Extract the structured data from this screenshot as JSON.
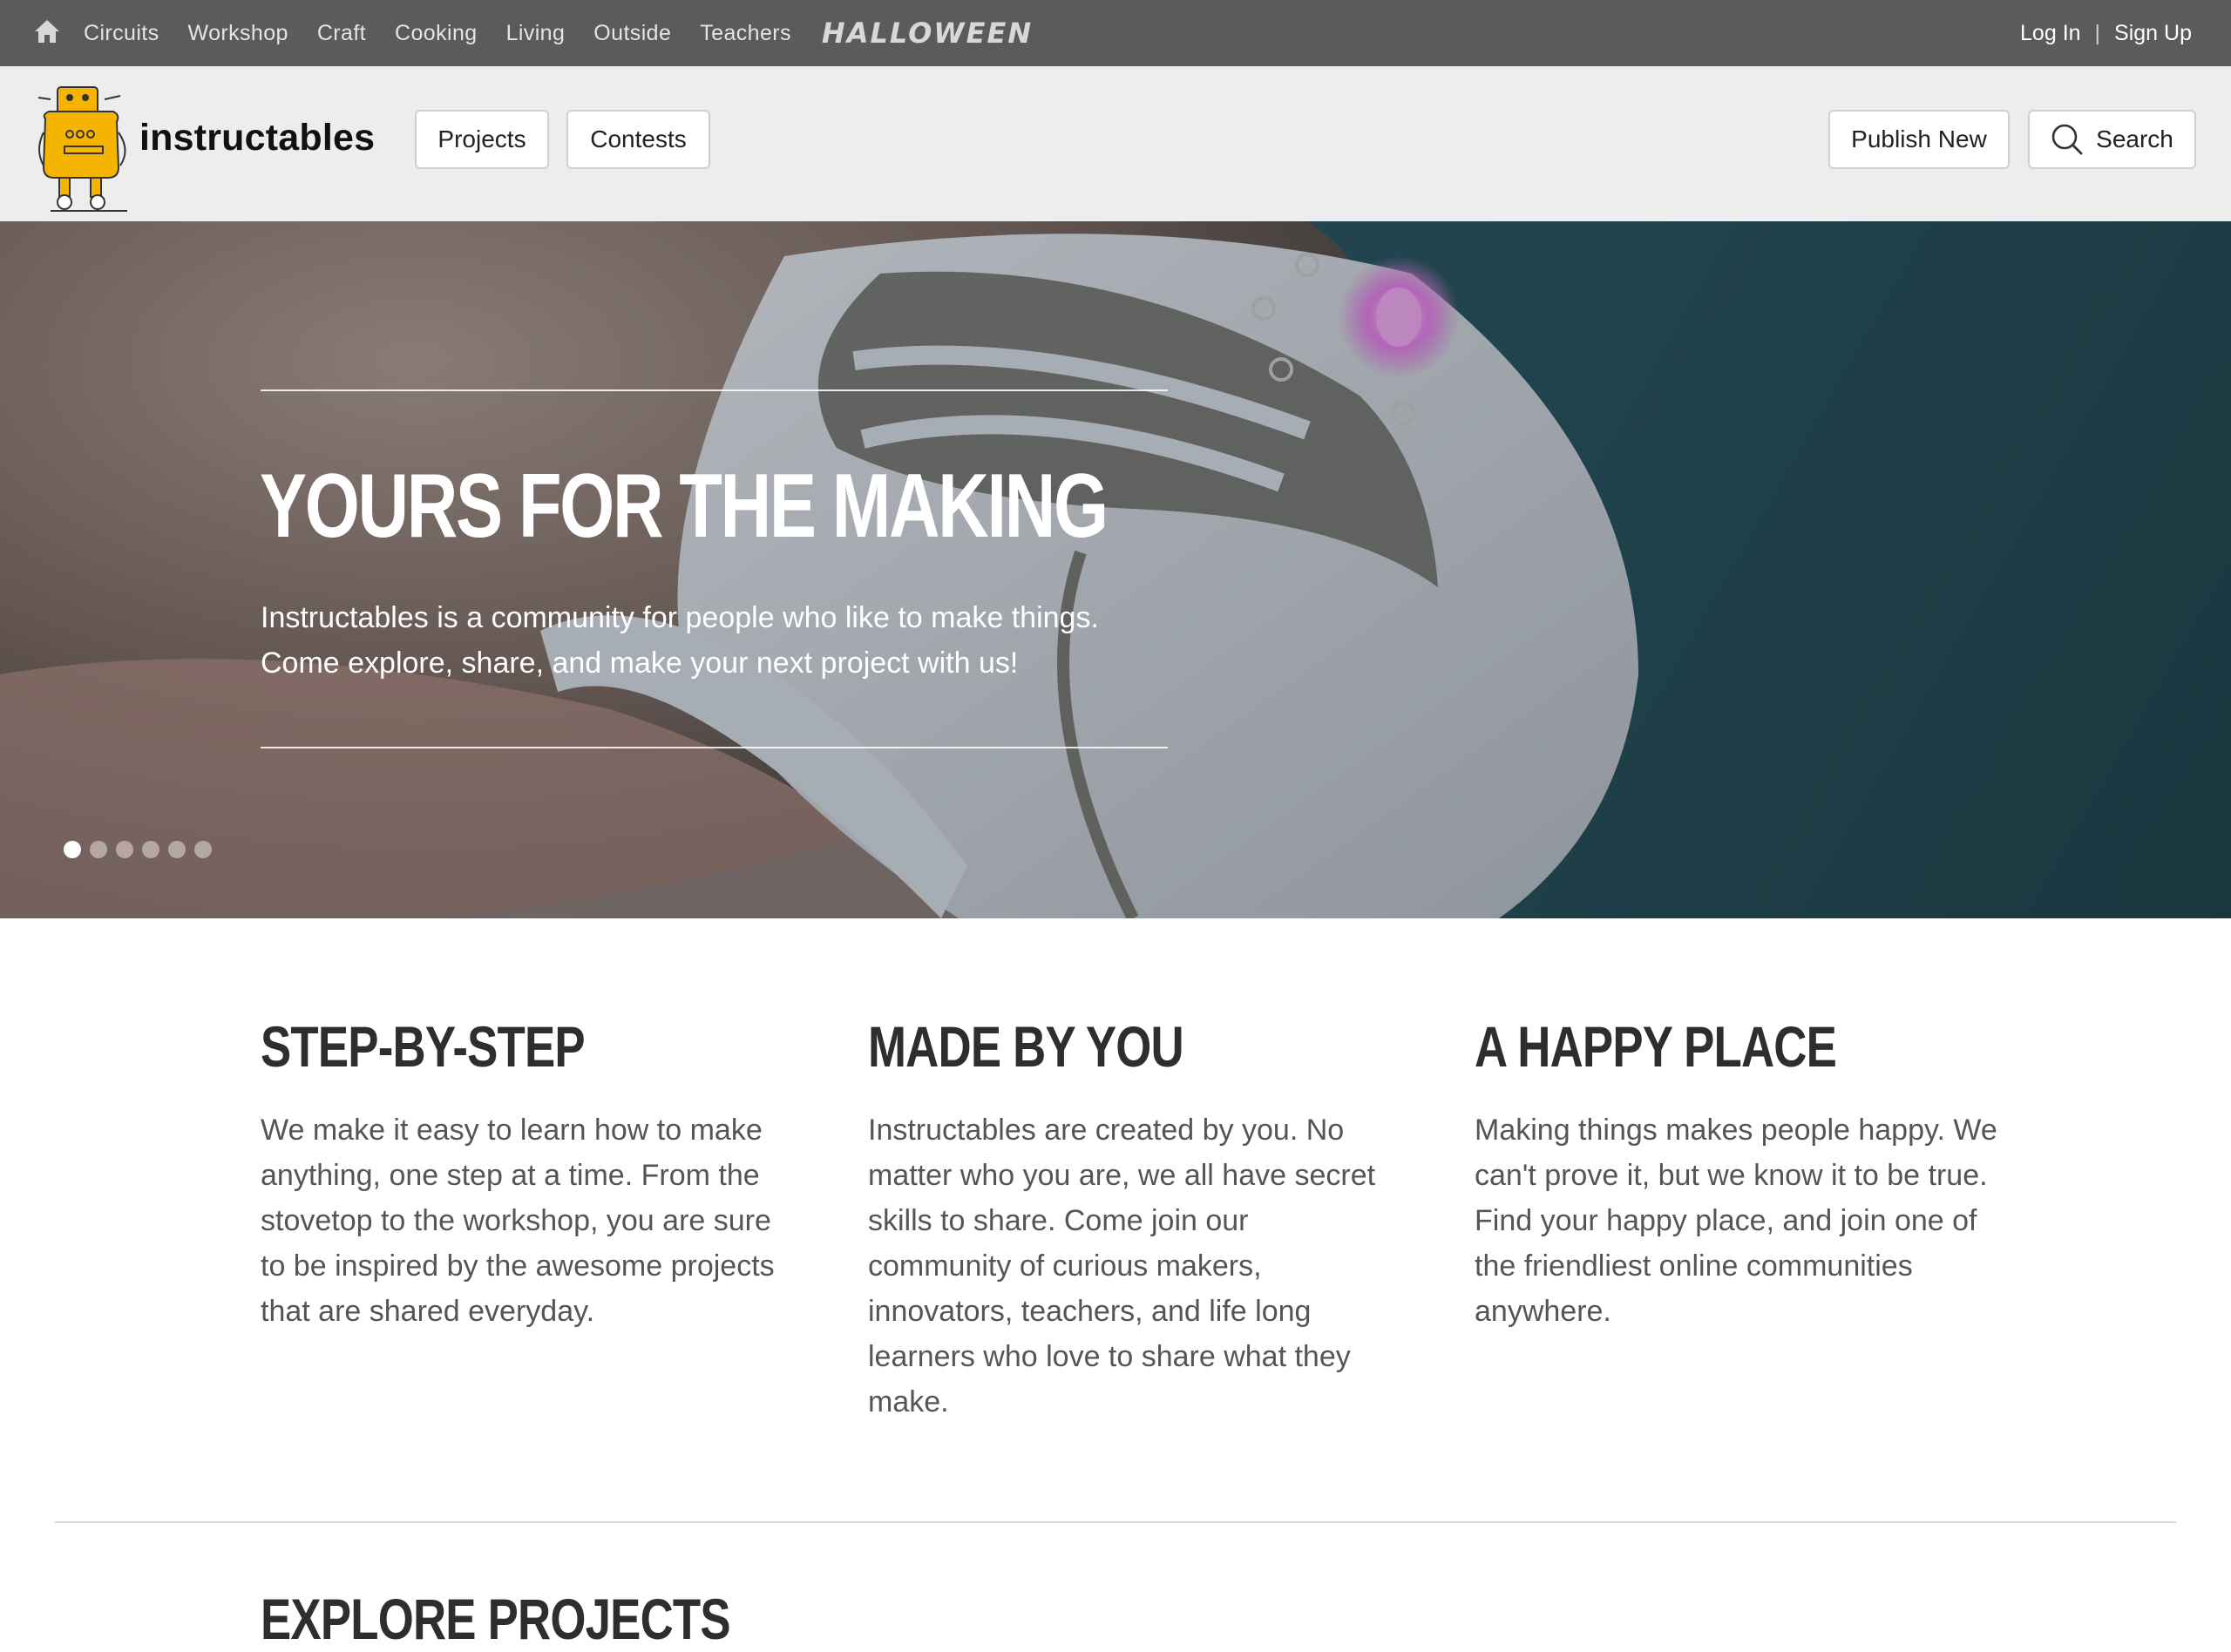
{
  "topnav": {
    "categories": [
      "Circuits",
      "Workshop",
      "Craft",
      "Cooking",
      "Living",
      "Outside",
      "Teachers"
    ],
    "halloween": "HALLOWEEN",
    "login": "Log In",
    "separator": "|",
    "signup": "Sign Up"
  },
  "header": {
    "logo_text": "instructables",
    "projects": "Projects",
    "contests": "Contests",
    "publish": "Publish New",
    "search": "Search"
  },
  "hero": {
    "title": "YOURS FOR THE MAKING",
    "line1": "Instructables is a community for people who like to make things.",
    "line2": "Come explore, share, and make your next project with us!",
    "slide_count": 6,
    "active_slide": 1
  },
  "features": [
    {
      "title": "STEP-BY-STEP",
      "text": "We make it easy to learn how to make anything, one step at a time. From the stovetop to the workshop, you are sure to be inspired by the awesome projects that are shared everyday."
    },
    {
      "title": "MADE BY YOU",
      "text": "Instructables are created by you. No matter who you are, we all have secret skills to share. Come join our community of curious makers, innovators, teachers, and life long learners who love to share what they make."
    },
    {
      "title": "A HAPPY PLACE",
      "text": "Making things makes people happy. We can't prove it, but we know it to be true. Find your happy place, and join one of the friendliest online communities anywhere."
    }
  ],
  "explore_title": "EXPLORE PROJECTS",
  "colors": {
    "topbar": "#5b5b5b",
    "header": "#ededed",
    "robot_yellow": "#f5b400"
  },
  "icons": {
    "home": "home-icon",
    "search": "search-icon",
    "logo": "robot-logo"
  }
}
